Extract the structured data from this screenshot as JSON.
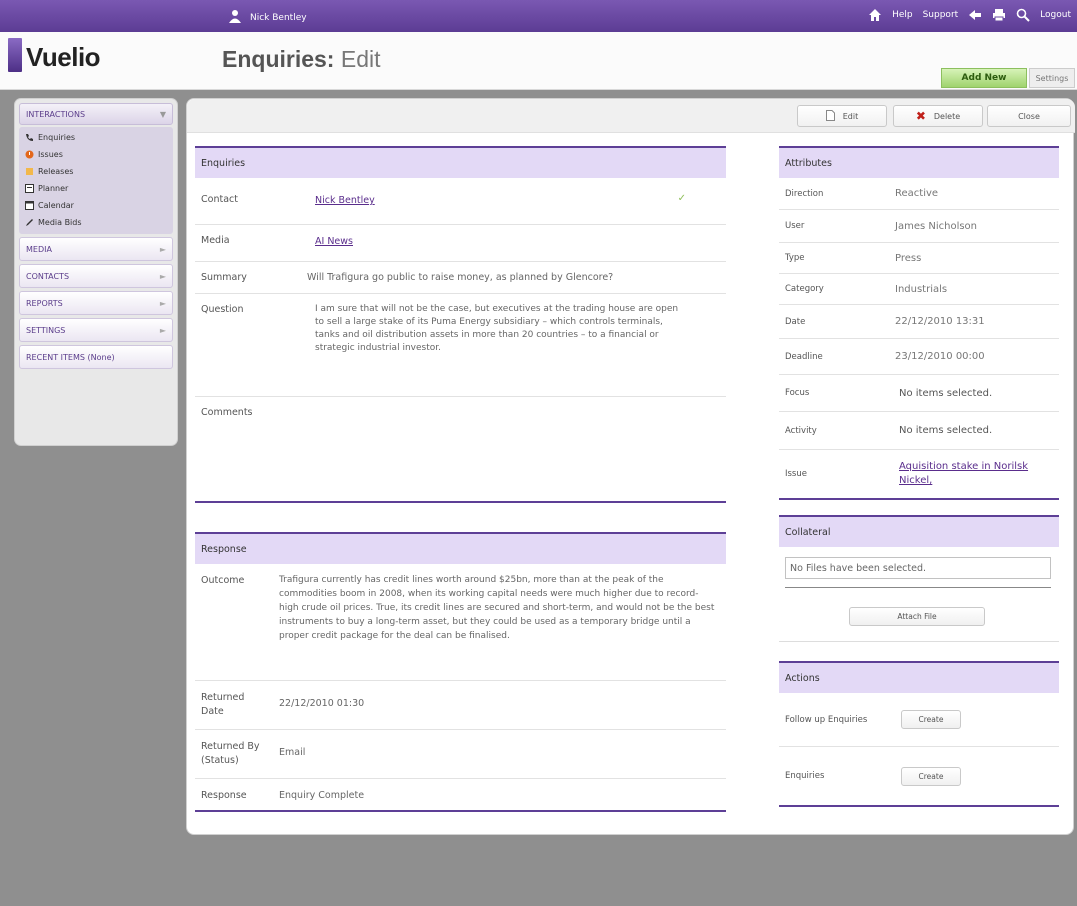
{
  "topbar": {
    "user_name": "Nick Bentley",
    "nav": [
      "Help",
      "Support",
      "Logout"
    ]
  },
  "app": {
    "logo_text": "Vuelio"
  },
  "page": {
    "title": "Enquiries:",
    "subtitle": "Edit"
  },
  "header_buttons": {
    "add_new": "Add New",
    "settings": "Settings"
  },
  "sidebar": {
    "interactions_label": "INTERACTIONS",
    "items": [
      {
        "label": "Enquiries",
        "icon": "phone-icon"
      },
      {
        "label": "Issues",
        "icon": "issue-icon"
      },
      {
        "label": "Releases",
        "icon": "release-icon"
      },
      {
        "label": "Planner",
        "icon": "planner-icon"
      },
      {
        "label": "Calendar",
        "icon": "calendar-icon"
      },
      {
        "label": "Media Bids",
        "icon": "pen-icon"
      }
    ],
    "sections": [
      "MEDIA",
      "CONTACTS",
      "REPORTS",
      "SETTINGS",
      "RECENT ITEMS (None)"
    ]
  },
  "toolbar": {
    "edit": "Edit",
    "delete": "Delete",
    "close": "Close"
  },
  "enquiries": {
    "title": "Enquiries",
    "contact_label": "Contact",
    "contact_value": "Nick Bentley",
    "media_label": "Media",
    "media_value": "AI News",
    "summary_label": "Summary",
    "summary_value": "Will Trafigura go public to raise money, as planned by Glencore?",
    "question_label": "Question",
    "question_value": "I am sure that will not be the case, but executives at the trading house are open to sell a large stake of its Puma Energy subsidiary – which controls terminals, tanks and oil distribution assets in more than 20 countries – to a financial or strategic industrial investor.",
    "comments_label": "Comments",
    "comments_value": ""
  },
  "response": {
    "title": "Response",
    "outcome_label": "Outcome",
    "outcome_value": "Trafigura currently has credit lines worth around $25bn, more than at the peak of the commodities boom in 2008, when its working capital needs were much higher due to record-high crude oil prices. True, its credit lines are secured and short-term, and would not be the best instruments to buy a long-term asset, but they could be used as a temporary bridge until a proper credit package for the deal can be finalised.",
    "returned_date_label": "Returned Date",
    "returned_date_value": "22/12/2010 01:30",
    "returned_by_label": "Returned By (Status)",
    "returned_by_value": "Email",
    "response_label": "Response",
    "response_value": "Enquiry Complete"
  },
  "attributes": {
    "title": "Attributes",
    "rows": [
      {
        "label": "Direction",
        "value": "Reactive"
      },
      {
        "label": "User",
        "value": "James Nicholson"
      },
      {
        "label": "Type",
        "value": "Press"
      },
      {
        "label": "Category",
        "value": "Industrials"
      },
      {
        "label": "Date",
        "value": "22/12/2010 13:31"
      },
      {
        "label": "Deadline",
        "value": "23/12/2010 00:00"
      },
      {
        "label": "Focus",
        "value": "No items selected."
      },
      {
        "label": "Activity",
        "value": "No items selected."
      },
      {
        "label": "Issue",
        "value": "Aquisition stake in Norilsk Nickel,"
      }
    ]
  },
  "collateral": {
    "title": "Collateral",
    "empty_text": "No Files have been selected.",
    "attach_button": "Attach File"
  },
  "actions": {
    "title": "Actions",
    "rows": [
      {
        "label": "Follow up Enquiries",
        "button": "Create"
      },
      {
        "label": "Enquiries",
        "button": "Create"
      }
    ]
  }
}
